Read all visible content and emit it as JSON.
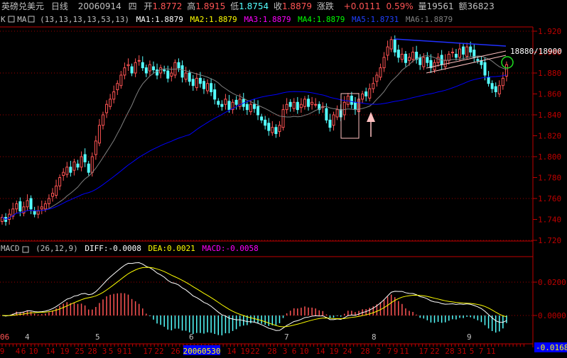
{
  "header": {
    "symbol": "英磅兑美元",
    "period": "日线",
    "date": "20060914",
    "weekday": "四",
    "open_label": "开",
    "open": "1.8772",
    "high_label": "高",
    "high": "1.8915",
    "low_label": "低",
    "low": "1.8754",
    "close_label": "收",
    "close": "1.8879",
    "change_label": "涨跌",
    "change": "+0.0111",
    "change_pct": "0.59%",
    "volume_label": "量",
    "volume": "19561",
    "amount_label": "额",
    "amount": "36823"
  },
  "ma_bar": {
    "k_label": "K",
    "ma_label": "MA",
    "params": "(13,13,13,13,53,13)",
    "ma1": "MA1:1.8879",
    "ma2": "MA2:1.8879",
    "ma3": "MA3:1.8879",
    "ma4": "MA4:1.8879",
    "ma5": "MA5:1.8731",
    "ma6": "MA6:1.8879"
  },
  "macd_bar": {
    "label": "MACD",
    "params": "(26,12,9)",
    "diff": "DIFF:-0.0008",
    "dea": "DEA:0.0021",
    "macd": "MACD:-0.0058"
  },
  "annotation": "18880/18900",
  "cursor_value": "-0.0168",
  "colors": {
    "up": "#ff5454",
    "down": "#54ffff",
    "grid": "#a00000",
    "axis": "#c00000",
    "ma_short": "#808080",
    "ma_long": "#0000ff",
    "diff": "#ffffff",
    "dea": "#ffff00",
    "ma1": "#ffffff",
    "ma2": "#ffff00",
    "ma3": "#ff00ff",
    "ma4": "#00ff00",
    "ma5": "#0000ff",
    "ma6": "#808080"
  },
  "price_axis": [
    "1.920",
    "1.900",
    "1.880",
    "1.860",
    "1.840",
    "1.820",
    "1.800",
    "1.780",
    "1.760",
    "1.740",
    "1.720"
  ],
  "macd_axis": [
    "0.0200",
    "0.0000"
  ],
  "month_labels": [
    "06",
    "4",
    "5",
    "6",
    "7",
    "8",
    "9"
  ],
  "date_labels": [
    "9",
    "4",
    "6",
    "10",
    "14",
    "19",
    "25",
    "28",
    "3",
    "5",
    "9",
    "11",
    "17",
    "22",
    "26",
    "20060530",
    "14",
    "19",
    "22",
    "28",
    "3",
    "6",
    "10",
    "14",
    "19",
    "24",
    "28",
    "2",
    "7",
    "9",
    "11",
    "17",
    "22",
    "28",
    "31",
    "5",
    "7",
    "11"
  ],
  "chart_data": {
    "type": "candlestick",
    "price_range": [
      1.72,
      1.925
    ],
    "closes": [
      1.742,
      1.738,
      1.745,
      1.75,
      1.755,
      1.748,
      1.752,
      1.758,
      1.75,
      1.745,
      1.748,
      1.752,
      1.755,
      1.76,
      1.765,
      1.772,
      1.78,
      1.785,
      1.79,
      1.785,
      1.795,
      1.79,
      1.8,
      1.795,
      1.785,
      1.8,
      1.815,
      1.83,
      1.84,
      1.85,
      1.855,
      1.862,
      1.87,
      1.878,
      1.885,
      1.888,
      1.88,
      1.89,
      1.892,
      1.885,
      1.88,
      1.888,
      1.883,
      1.878,
      1.885,
      1.882,
      1.875,
      1.88,
      1.89,
      1.885,
      1.876,
      1.88,
      1.872,
      1.868,
      1.875,
      1.87,
      1.865,
      1.87,
      1.862,
      1.855,
      1.85,
      1.848,
      1.855,
      1.845,
      1.852,
      1.85,
      1.855,
      1.848,
      1.845,
      1.85,
      1.846,
      1.84,
      1.835,
      1.83,
      1.825,
      1.828,
      1.822,
      1.83,
      1.845,
      1.85,
      1.848,
      1.852,
      1.845,
      1.85,
      1.855,
      1.848,
      1.852,
      1.85,
      1.845,
      1.848,
      1.835,
      1.828,
      1.84,
      1.845,
      1.838,
      1.852,
      1.858,
      1.85,
      1.845,
      1.855,
      1.86,
      1.858,
      1.865,
      1.87,
      1.878,
      1.885,
      1.895,
      1.905,
      1.912,
      1.9,
      1.895,
      1.898,
      1.89,
      1.895,
      1.9,
      1.893,
      1.888,
      1.895,
      1.89,
      1.885,
      1.89,
      1.895,
      1.888,
      1.892,
      1.898,
      1.9,
      1.895,
      1.903,
      1.898,
      1.905,
      1.9,
      1.895,
      1.892,
      1.888,
      1.878,
      1.87,
      1.865,
      1.862,
      1.868,
      1.875,
      1.888
    ],
    "ma_periods": [
      13,
      53
    ],
    "macd_params": [
      26,
      12,
      9
    ]
  }
}
